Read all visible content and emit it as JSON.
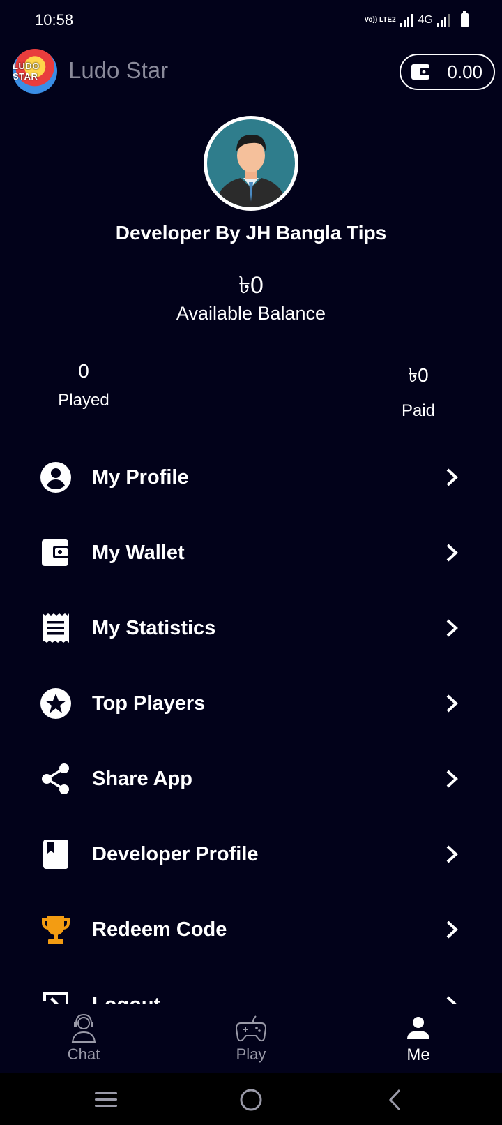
{
  "status": {
    "time": "10:58",
    "volte": "Vo)) LTE2",
    "network": "4G"
  },
  "header": {
    "logo_text": "LUDO STAR",
    "title": "Ludo Star",
    "wallet_balance": "0.00"
  },
  "profile": {
    "name": "Developer By JH Bangla Tips",
    "balance": "৳0",
    "balance_label": "Available Balance",
    "stats": {
      "played_value": "0",
      "played_label": "Played",
      "paid_value": "৳0",
      "paid_label": "Paid"
    }
  },
  "menu": {
    "items": [
      {
        "label": "My Profile",
        "icon": "account-circle-icon"
      },
      {
        "label": "My Wallet",
        "icon": "wallet-icon"
      },
      {
        "label": "My Statistics",
        "icon": "receipt-icon"
      },
      {
        "label": "Top Players",
        "icon": "star-circle-icon"
      },
      {
        "label": "Share App",
        "icon": "share-icon"
      },
      {
        "label": "Developer Profile",
        "icon": "bookmark-book-icon"
      },
      {
        "label": "Redeem Code",
        "icon": "trophy-icon"
      },
      {
        "label": "Logout",
        "icon": "logout-icon"
      }
    ]
  },
  "bottom_nav": {
    "tabs": [
      {
        "label": "Chat",
        "icon": "support-agent-icon"
      },
      {
        "label": "Play",
        "icon": "gamepad-icon"
      },
      {
        "label": "Me",
        "icon": "person-icon",
        "active": true
      }
    ]
  },
  "colors": {
    "background": "#02021a",
    "trophy": "#f39c12",
    "inactive": "#9a9aa8"
  }
}
